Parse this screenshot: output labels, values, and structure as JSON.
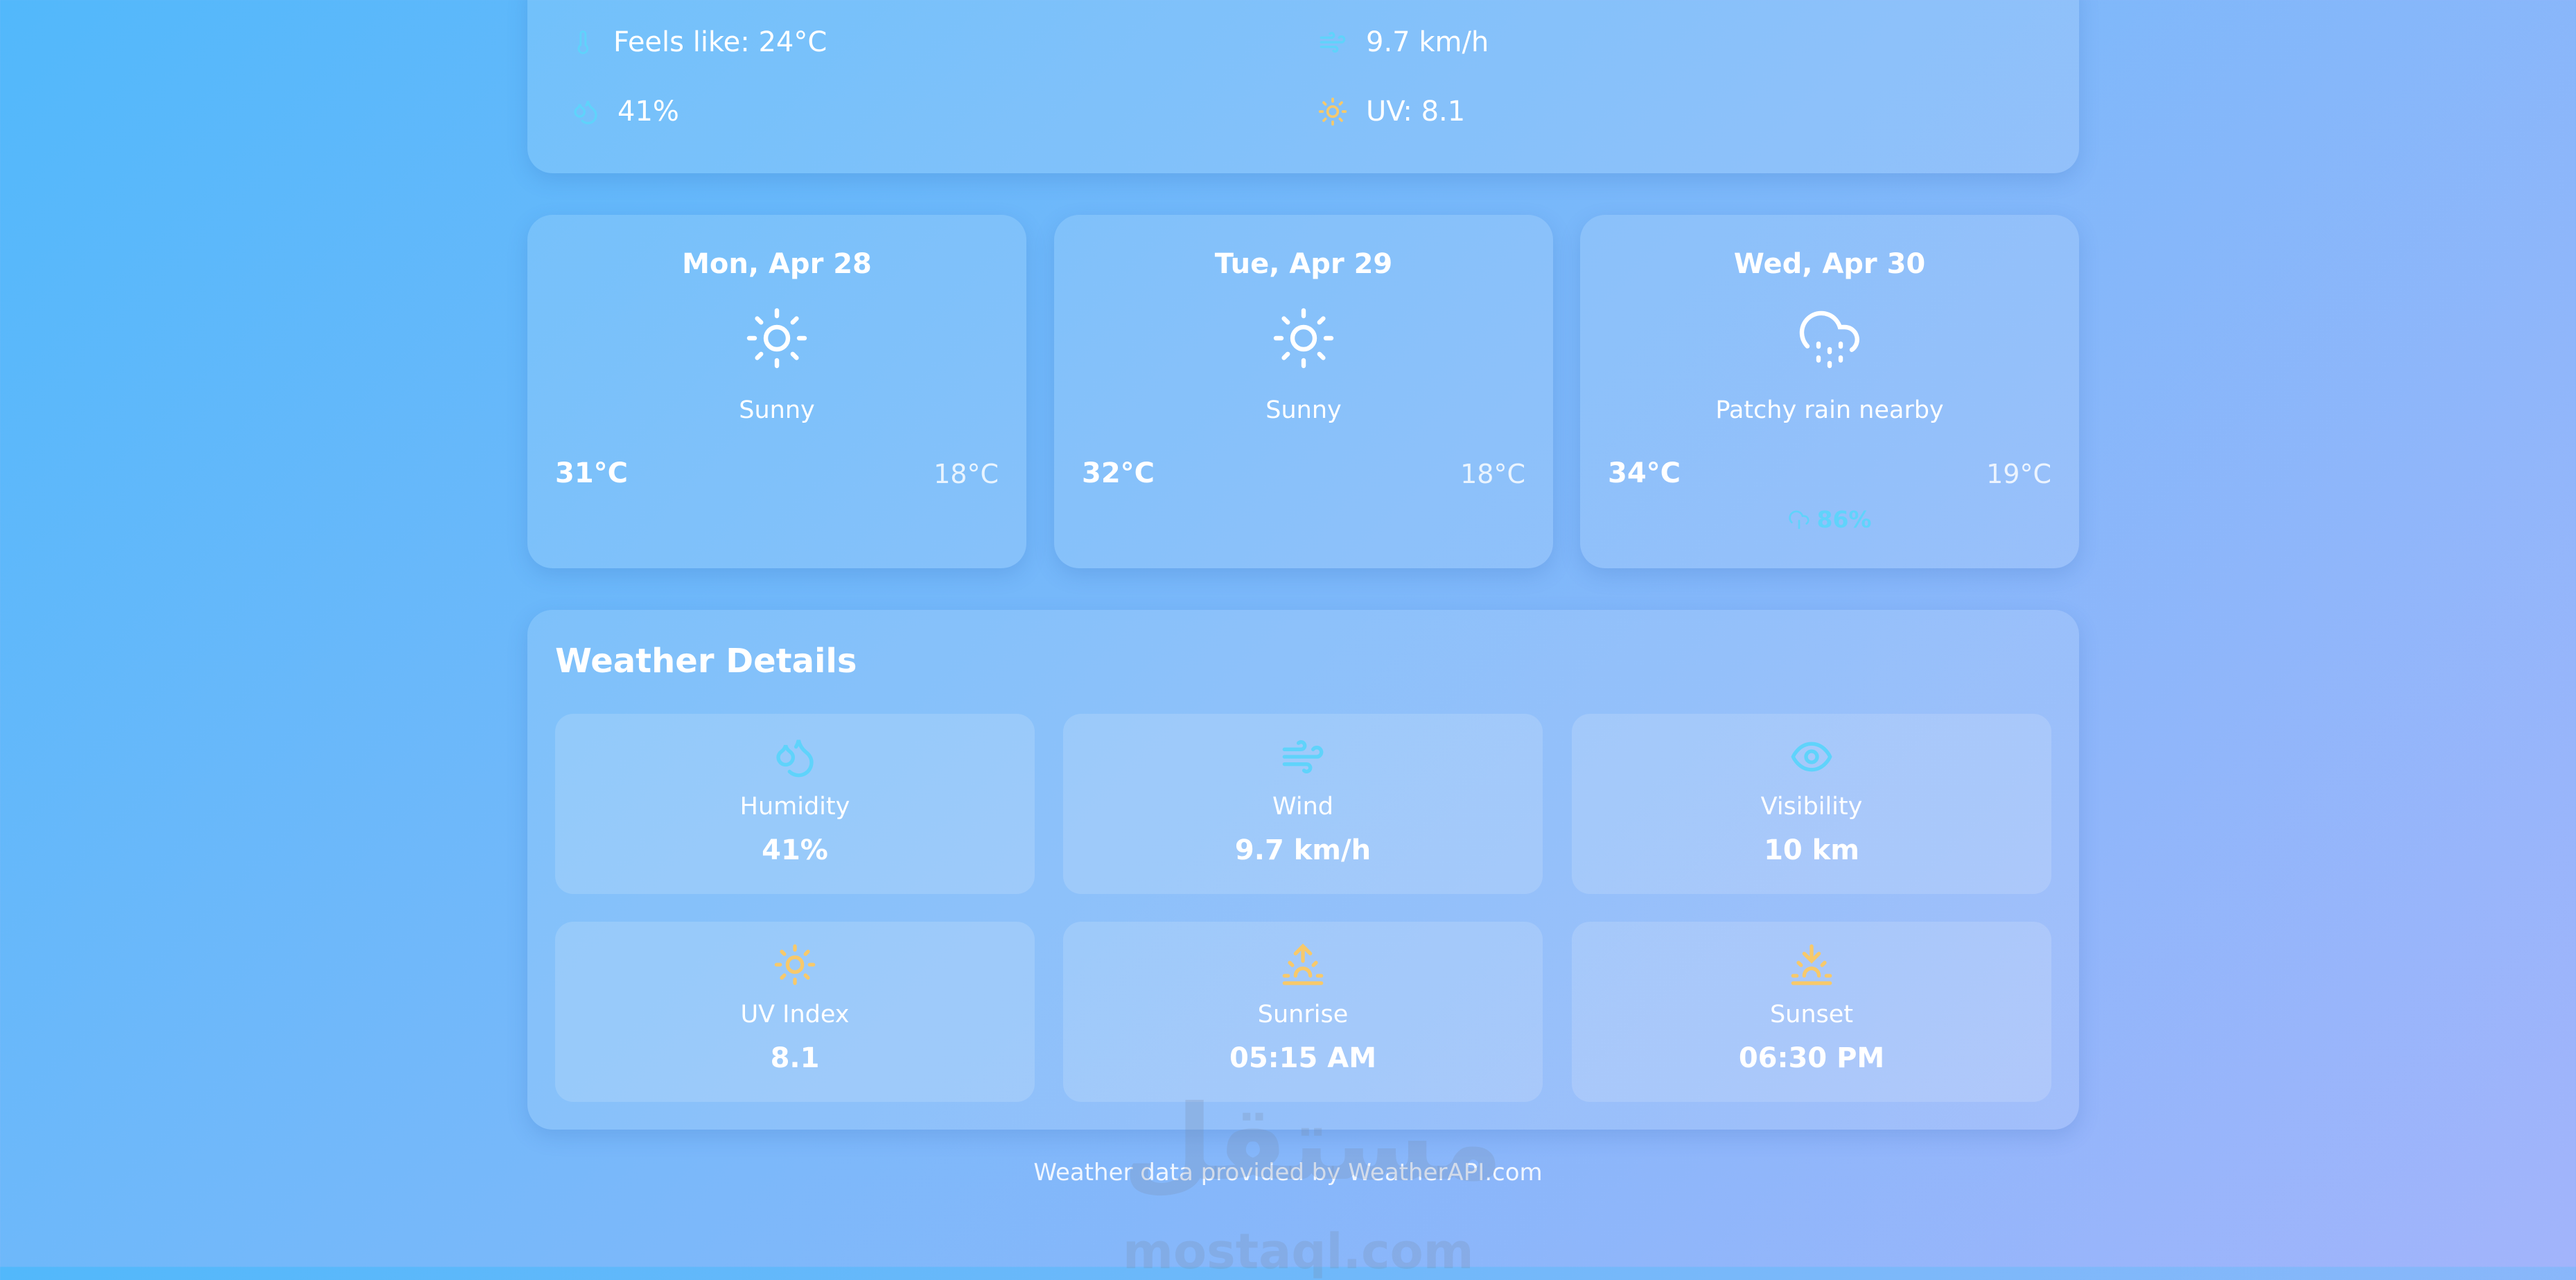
{
  "current": {
    "feels_like": "Feels like: 24°C",
    "wind": "9.7 km/h",
    "humidity": "41%",
    "uv": "UV: 8.1",
    "icons": [
      "thermometer-icon",
      "wind-icon",
      "droplet-icon",
      "sun-icon"
    ]
  },
  "forecast": [
    {
      "date": "Mon, Apr 28",
      "condition": "Sunny",
      "high": "31°C",
      "low": "18°C",
      "icon": "sun-icon"
    },
    {
      "date": "Tue, Apr 29",
      "condition": "Sunny",
      "high": "32°C",
      "low": "18°C",
      "icon": "sun-icon"
    },
    {
      "date": "Wed, Apr 30",
      "condition": "Patchy rain nearby",
      "high": "34°C",
      "low": "19°C",
      "rain_chance": "86%",
      "icon": "cloud-rain-icon"
    }
  ],
  "details": {
    "title": "Weather Details",
    "items": [
      {
        "label": "Humidity",
        "value": "41%",
        "icon": "droplets-icon"
      },
      {
        "label": "Wind",
        "value": "9.7 km/h",
        "icon": "wind-icon"
      },
      {
        "label": "Visibility",
        "value": "10 km",
        "icon": "eye-icon"
      },
      {
        "label": "UV Index",
        "value": "8.1",
        "icon": "sun-icon"
      },
      {
        "label": "Sunrise",
        "value": "05:15 AM",
        "icon": "sunrise-icon"
      },
      {
        "label": "Sunset",
        "value": "06:30 PM",
        "icon": "sunset-icon"
      }
    ]
  },
  "footer": "Weather data provided by WeatherAPI.com",
  "watermark": {
    "arabic": "مستقل",
    "latin": "mostaql.com"
  },
  "colors": {
    "accent_cyan": "#5fd3fb",
    "accent_yellow": "#f7c96b"
  }
}
